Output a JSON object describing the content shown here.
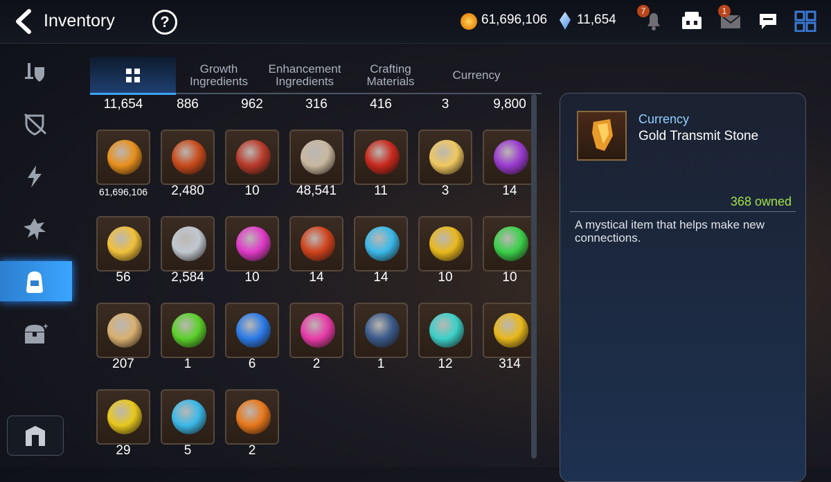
{
  "header": {
    "title": "Inventory",
    "help_label": "?",
    "gold": "61,696,106",
    "crystals": "11,654",
    "notification_count": "7",
    "mail_count": "1"
  },
  "tabs": [
    {
      "label": "",
      "icon": "grid-icon",
      "active": true
    },
    {
      "label": "Growth\nIngredients"
    },
    {
      "label": "Enhancement\nIngredients"
    },
    {
      "label": "Crafting\nMaterials"
    },
    {
      "label": "Currency"
    }
  ],
  "sidebar": [
    "equipment-icon",
    "no-gear-icon",
    "lightning-icon",
    "artifact-icon",
    "bag-icon",
    "chest-icon"
  ],
  "top_row_counts": [
    "11,654",
    "886",
    "962",
    "316",
    "416",
    "3",
    "9,800"
  ],
  "items": [
    {
      "name": "gold-coin",
      "count": "61,696,106",
      "color": "#e8901c"
    },
    {
      "name": "fist-emblem",
      "count": "2,480",
      "color": "#c84a1a"
    },
    {
      "name": "banner",
      "count": "10",
      "color": "#b83a2a"
    },
    {
      "name": "knight-piece",
      "count": "48,541",
      "color": "#c8b8a0"
    },
    {
      "name": "flame-leaf",
      "count": "11",
      "color": "#c8281c"
    },
    {
      "name": "mascot",
      "count": "3",
      "color": "#f0c860"
    },
    {
      "name": "purple-flower",
      "count": "14",
      "color": "#9a3ad0"
    },
    {
      "name": "gold-flower",
      "count": "56",
      "color": "#f0c03a"
    },
    {
      "name": "silver-flower",
      "count": "2,584",
      "color": "#c0c8d0"
    },
    {
      "name": "pink-rune",
      "count": "10",
      "color": "#e03ac8"
    },
    {
      "name": "red-rune",
      "count": "14",
      "color": "#d0421c"
    },
    {
      "name": "blue-rune",
      "count": "14",
      "color": "#3ab8e8"
    },
    {
      "name": "yellow-rune",
      "count": "10",
      "color": "#e8b81c"
    },
    {
      "name": "green-rune",
      "count": "10",
      "color": "#3ad04a"
    },
    {
      "name": "root",
      "count": "207",
      "color": "#d8b070"
    },
    {
      "name": "green-orb",
      "count": "1",
      "color": "#5ad02a"
    },
    {
      "name": "blue-portal",
      "count": "6",
      "color": "#2a7ae8"
    },
    {
      "name": "pink-potion",
      "count": "2",
      "color": "#e83aa8"
    },
    {
      "name": "blue-stone",
      "count": "1",
      "color": "#3a5a8a"
    },
    {
      "name": "star-stone",
      "count": "12",
      "color": "#3ad0c8"
    },
    {
      "name": "gold-stone",
      "count": "314",
      "color": "#e8b81c"
    },
    {
      "name": "lightning-stone",
      "count": "29",
      "color": "#e8c81c"
    },
    {
      "name": "white-star-stone",
      "count": "5",
      "color": "#3ab8e8"
    },
    {
      "name": "orange-stone",
      "count": "2",
      "color": "#e8781c"
    }
  ],
  "detail": {
    "category": "Currency",
    "name": "Gold Transmit Stone",
    "owned": "368 owned",
    "description": "A mystical item that helps make new connections."
  }
}
